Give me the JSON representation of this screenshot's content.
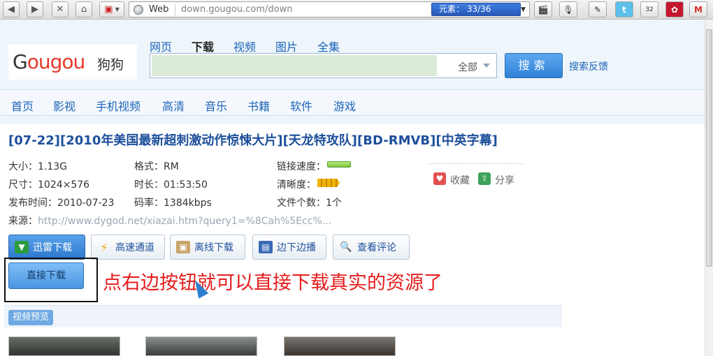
{
  "browser": {
    "web_label": "Web",
    "url": "down.gougou.com/down",
    "element_label": "元素：  33/36",
    "badge_count": "32"
  },
  "header": {
    "logo_text_g": "G",
    "logo_text_ougou": "ougou",
    "logo_cn": "狗狗",
    "nav": [
      {
        "label": "网页"
      },
      {
        "label": "下载"
      },
      {
        "label": "视频"
      },
      {
        "label": "图片"
      },
      {
        "label": "全集"
      }
    ],
    "search_scope": "全部",
    "search_button": "搜索",
    "feedback": "搜索反馈"
  },
  "categories": [
    {
      "label": "首页"
    },
    {
      "label": "影视"
    },
    {
      "label": "手机视频"
    },
    {
      "label": "高清"
    },
    {
      "label": "音乐"
    },
    {
      "label": "书籍"
    },
    {
      "label": "软件"
    },
    {
      "label": "游戏"
    }
  ],
  "resource": {
    "title": "[07-22][2010年美国最新超刺激动作惊悚大片][天龙特攻队][BD-RMVB][中英字幕]",
    "size": "大小：1.13G",
    "format": "格式：RM",
    "speed_label": "链接速度：",
    "dimensions": "尺寸：1024×576",
    "duration": "时长：01:53:50",
    "clarity_label": "清晰度：",
    "published": "发布时间：2010-07-23",
    "bitrate": "码率：1384kbps",
    "file_count": "文件个数：1个",
    "source_label": "来源：",
    "source_link": "http://www.dygod.net/xiazai.htm?query1=%8Cah%5Ecc%...",
    "favorite": "收藏",
    "share": "分享"
  },
  "buttons": {
    "thunder": "迅雷下载",
    "fast": "高速通道",
    "offline": "离线下载",
    "stream": "边下边播",
    "review": "查看评论",
    "direct": "直接下载"
  },
  "annotation": "点右边按钮就可以直接下载真实的资源了",
  "preview": {
    "label": "视频预览"
  }
}
